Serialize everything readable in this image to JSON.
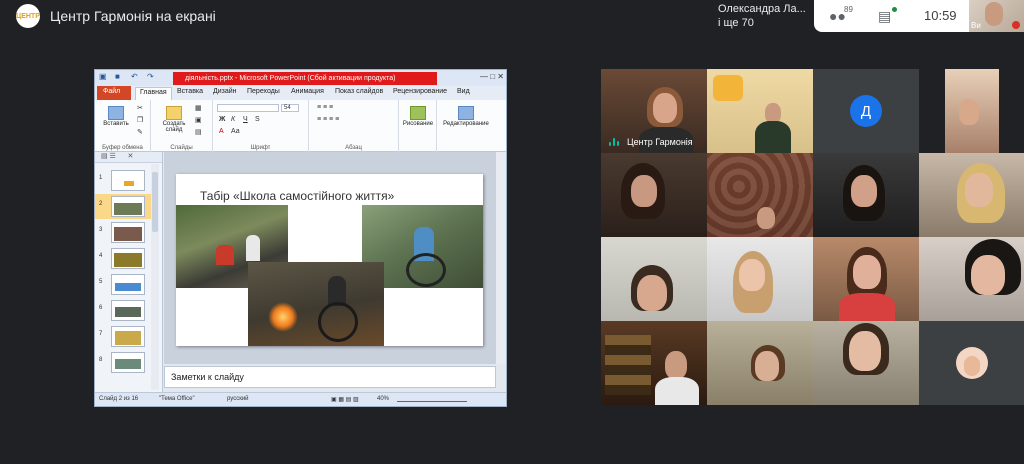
{
  "meet": {
    "logo_text": "ЦЕНТР",
    "presenting_label": "Центр Гармонія на екрані",
    "participants_line1": "Олександра Ла...",
    "participants_line2": "і ще 70",
    "people_count": "89",
    "time": "10:59",
    "self_name": "Ви"
  },
  "ppt": {
    "window_title": "діяльність.pptx - Microsoft PowerPoint (Сбой активации продукта)",
    "tabs": [
      "Файл",
      "Главная",
      "Вставка",
      "Дизайн",
      "Переходы",
      "Анимация",
      "Показ слайдов",
      "Рецензирование",
      "Вид"
    ],
    "groups": {
      "clipboard": "Буфер обмена",
      "slides": "Слайды",
      "font": "Шрифт",
      "paragraph": "Абзац"
    },
    "buttons": {
      "paste": "Вставить",
      "new_slide": "Создать слайд",
      "drawing": "Рисование",
      "editing": "Редактирование"
    },
    "font_size": "54",
    "slide_title": "Табір «Школа самостійного життя»",
    "thumb_numbers": [
      "1",
      "2",
      "3",
      "4",
      "5",
      "6",
      "7",
      "8"
    ],
    "notes_placeholder": "Заметки к слайду",
    "status": {
      "slide_of": "Слайд 2 из 16",
      "theme": "\"Тема Office\"",
      "language": "русский",
      "zoom": "40%"
    }
  },
  "grid": {
    "presenter_name": "Центр Гармонія",
    "avatar_letter": "Д",
    "avatar_color": "#1a73e8"
  }
}
